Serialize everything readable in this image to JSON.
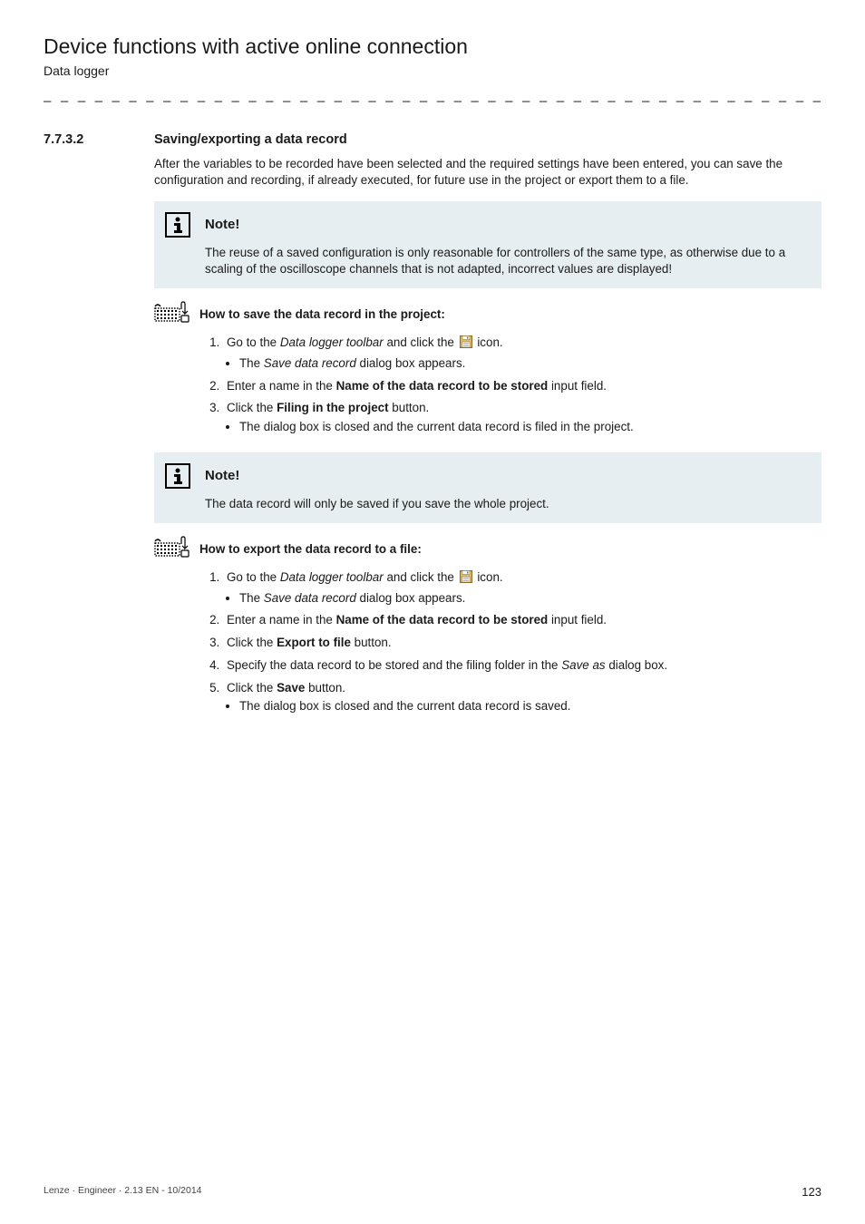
{
  "chapter": {
    "title": "Device functions with active online connection",
    "subtitle": "Data logger"
  },
  "section": {
    "number": "7.7.3.2",
    "title": "Saving/exporting a data record"
  },
  "intro": "After the variables to be recorded have been selected and the required settings have been entered, you can save the configuration and recording, if already executed, for future use in the project or export them to a file.",
  "note1": {
    "heading": "Note!",
    "body": "The reuse of a saved configuration is only reasonable for controllers of the same type, as otherwise due to a scaling of the oscilloscope channels that is not adapted, incorrect values are displayed!"
  },
  "howto1": {
    "title": "How to save the data record in the project:",
    "step1_a": "Go to the ",
    "step1_b": "Data logger toolbar",
    "step1_c": " and click the ",
    "step1_d": " icon.",
    "step1_sub_a": "The ",
    "step1_sub_b": "Save data record",
    "step1_sub_c": " dialog box appears.",
    "step2_a": "Enter a name in the ",
    "step2_b": "Name of the data record to be stored",
    "step2_c": " input field.",
    "step3_a": "Click the ",
    "step3_b": "Filing in the project",
    "step3_c": " button.",
    "step3_sub": "The dialog box is closed and the current data record is filed in the project."
  },
  "note2": {
    "heading": "Note!",
    "body": "The data record will only be saved if you save the whole project."
  },
  "howto2": {
    "title": "How to export the data record to a file:",
    "step1_a": "Go to the ",
    "step1_b": "Data logger toolbar",
    "step1_c": " and click the ",
    "step1_d": " icon.",
    "step1_sub_a": "The ",
    "step1_sub_b": "Save data record",
    "step1_sub_c": " dialog box appears.",
    "step2_a": "Enter a name in the ",
    "step2_b": "Name of the data record to be stored",
    "step2_c": " input field.",
    "step3_a": "Click the ",
    "step3_b": "Export to file",
    "step3_c": " button.",
    "step4_a": "Specify the data record to be stored and the filing folder in the ",
    "step4_b": "Save as",
    "step4_c": " dialog box.",
    "step5_a": "Click the ",
    "step5_b": "Save",
    "step5_c": " button.",
    "step5_sub": "The dialog box is closed and the current data record is saved."
  },
  "footer": {
    "left": "Lenze · Engineer · 2.13 EN - 10/2014",
    "page": "123"
  }
}
